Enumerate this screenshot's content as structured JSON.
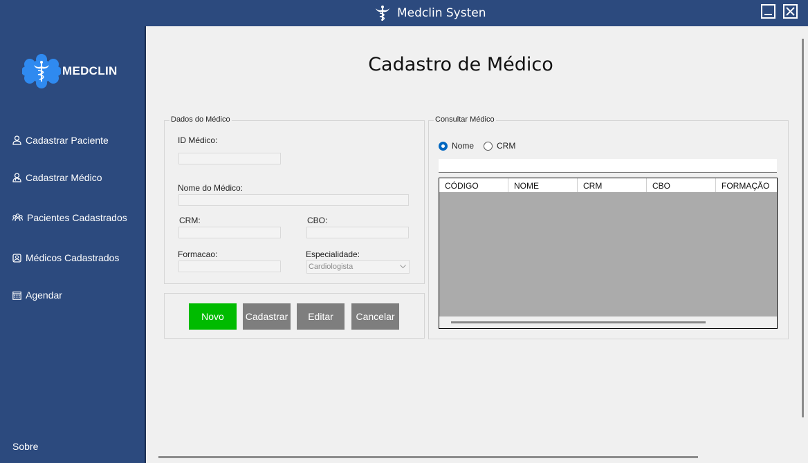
{
  "window": {
    "title": "Medclin Systen",
    "title_icon": "caduceus-icon",
    "minimize_icon": "minimize-icon",
    "close_icon": "close-icon"
  },
  "sidebar": {
    "logo_text": "MEDCLIN",
    "logo_icon": "medical-star-caduceus-logo",
    "items": [
      {
        "label": "Cadastrar Paciente",
        "icon": "user-icon"
      },
      {
        "label": "Cadastrar Médico",
        "icon": "doctor-icon"
      },
      {
        "label": "Pacientes Cadastrados",
        "icon": "group-icon"
      },
      {
        "label": "Médicos Cadastrados",
        "icon": "medical-kit-icon"
      },
      {
        "label": "Agendar",
        "icon": "calendar-icon"
      }
    ],
    "footer_label": "Sobre"
  },
  "main": {
    "page_title": "Cadastro de Médico",
    "dados": {
      "legend": "Dados do Médico",
      "id_label": "ID Médico:",
      "id_value": "",
      "nome_label": "Nome do Médico:",
      "nome_value": "",
      "crm_label": "CRM:",
      "crm_value": "",
      "cbo_label": "CBO:",
      "cbo_value": "",
      "formacao_label": "Formacao:",
      "formacao_value": "",
      "especialidade_label": "Especialidade:",
      "especialidade_value": "Cardiologista"
    },
    "buttons": {
      "novo": "Novo",
      "cadastrar": "Cadastrar",
      "editar": "Editar",
      "cancelar": "Cancelar"
    },
    "consulta": {
      "legend": "Consultar Médico",
      "radio_nome": "Nome",
      "radio_crm": "CRM",
      "selected": "Nome",
      "search_value": "",
      "columns": [
        "CÓDIGO",
        "NOME",
        "CRM",
        "CBO",
        "FORMAÇÃO"
      ],
      "rows": []
    }
  },
  "colors": {
    "sidebar_bg": "#2c4a7e",
    "content_bg": "#f0f0f0",
    "novo_button": "#00bb00",
    "action_button": "#7e7e7e",
    "grid_bg": "#ababab",
    "radio_selected": "#0067c0"
  }
}
